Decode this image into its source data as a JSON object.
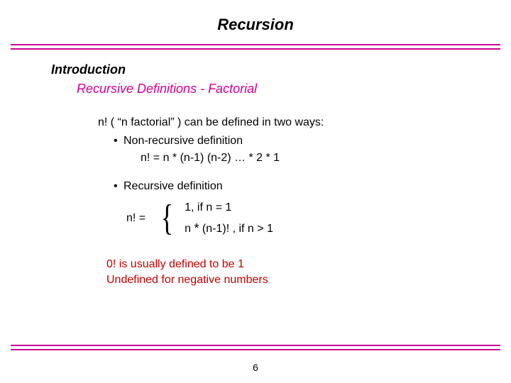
{
  "title": "Recursion",
  "section": "Introduction",
  "subheading": "Recursive Definitions - Factorial",
  "intro_line": "n! ( “n factorial” ) can be defined in two ways:",
  "bullets": {
    "nonrec_label": "Non-recursive definition",
    "nonrec_formula": "n! = n * (n-1) (n-2) … * 2 * 1",
    "rec_label": "Recursive definition"
  },
  "piecewise": {
    "lhs": "n! =",
    "case1": "1, if n = 1",
    "case2_pre": "n ",
    "case2_star": "*",
    "case2_post": " (n-1)! , if n > 1"
  },
  "notes": {
    "n1": "0! is usually defined to be 1",
    "n2": "Undefined for negative numbers"
  },
  "page": "6",
  "glyphs": {
    "bullet": "•",
    "brace": "{"
  }
}
